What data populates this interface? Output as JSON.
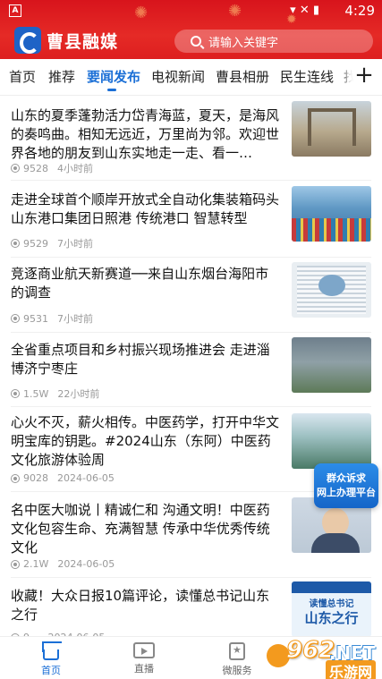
{
  "status_bar": {
    "badge": "A",
    "time": "4:29",
    "icons": "▾ ✕ ▮"
  },
  "header": {
    "app_name": "曹县融媒",
    "search_placeholder": "请输入关键字"
  },
  "tabs": [
    {
      "label": "首页",
      "active": false
    },
    {
      "label": "推荐",
      "active": false
    },
    {
      "label": "要闻发布",
      "active": true
    },
    {
      "label": "电视新闻",
      "active": false
    },
    {
      "label": "曹县相册",
      "active": false
    },
    {
      "label": "民生连线",
      "active": false
    },
    {
      "label": "找",
      "active": false
    }
  ],
  "tab_add_label": "+",
  "news": [
    {
      "title": "山东的夏季蓬勃活力岱青海蓝，夏天，是海风的奏鸣曲。相知无远近，万里尚为邻。欢迎世界各地的朋友到山东实地走一走、看一…",
      "views": "9528",
      "time": "4小时前"
    },
    {
      "title": "走进全球首个顺岸开放式全自动化集装箱码头山东港口集团日照港  传统港口  智慧转型",
      "views": "9529",
      "time": "7小时前"
    },
    {
      "title": "竞逐商业航天新赛道──来自山东烟台海阳市的调查",
      "views": "9531",
      "time": "7小时前"
    },
    {
      "title": "全省重点项目和乡村振兴现场推进会  走进淄博济宁枣庄",
      "views": "1.5W",
      "time": "22小时前"
    },
    {
      "title": "心火不灭，薪火相传。中医药学，打开中华文明宝库的钥匙。#2024山东（东阿）中医药文化旅游体验周",
      "views": "9028",
      "time": "2024-06-05"
    },
    {
      "title": "名中医大咖说丨精诚仁和    沟通文明！中医药文化包容生命、充满智慧    传承中华优秀传统文化",
      "views": "2.1W",
      "time": "2024-06-05"
    },
    {
      "title": "收藏！大众日报10篇评论，读懂总书记山东之行",
      "views": "9...",
      "time": "2024-06-05"
    }
  ],
  "thumb7": {
    "line1": "读懂总书记",
    "line2": "山东之行"
  },
  "float_badge": {
    "line1": "群众诉求",
    "line2": "网上办理平台"
  },
  "bottom_nav": [
    {
      "label": "首页",
      "active": true
    },
    {
      "label": "直播",
      "active": false
    },
    {
      "label": "微服务",
      "active": false
    }
  ],
  "watermark": {
    "num": "962",
    "net": ".NET",
    "text": "乐游网"
  },
  "colors": {
    "header_red": "#e0231f",
    "accent_blue": "#1b6fd6"
  }
}
